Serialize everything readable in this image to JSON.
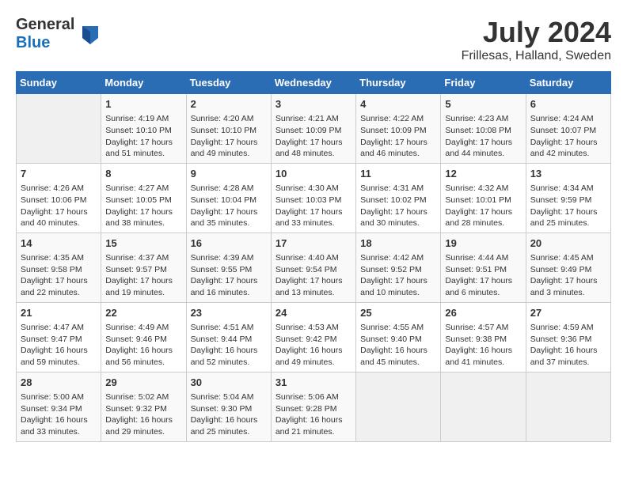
{
  "logo": {
    "general": "General",
    "blue": "Blue"
  },
  "title": "July 2024",
  "location": "Frillesas, Halland, Sweden",
  "days_header": [
    "Sunday",
    "Monday",
    "Tuesday",
    "Wednesday",
    "Thursday",
    "Friday",
    "Saturday"
  ],
  "weeks": [
    [
      {
        "day": "",
        "info": ""
      },
      {
        "day": "1",
        "info": "Sunrise: 4:19 AM\nSunset: 10:10 PM\nDaylight: 17 hours\nand 51 minutes."
      },
      {
        "day": "2",
        "info": "Sunrise: 4:20 AM\nSunset: 10:10 PM\nDaylight: 17 hours\nand 49 minutes."
      },
      {
        "day": "3",
        "info": "Sunrise: 4:21 AM\nSunset: 10:09 PM\nDaylight: 17 hours\nand 48 minutes."
      },
      {
        "day": "4",
        "info": "Sunrise: 4:22 AM\nSunset: 10:09 PM\nDaylight: 17 hours\nand 46 minutes."
      },
      {
        "day": "5",
        "info": "Sunrise: 4:23 AM\nSunset: 10:08 PM\nDaylight: 17 hours\nand 44 minutes."
      },
      {
        "day": "6",
        "info": "Sunrise: 4:24 AM\nSunset: 10:07 PM\nDaylight: 17 hours\nand 42 minutes."
      }
    ],
    [
      {
        "day": "7",
        "info": "Sunrise: 4:26 AM\nSunset: 10:06 PM\nDaylight: 17 hours\nand 40 minutes."
      },
      {
        "day": "8",
        "info": "Sunrise: 4:27 AM\nSunset: 10:05 PM\nDaylight: 17 hours\nand 38 minutes."
      },
      {
        "day": "9",
        "info": "Sunrise: 4:28 AM\nSunset: 10:04 PM\nDaylight: 17 hours\nand 35 minutes."
      },
      {
        "day": "10",
        "info": "Sunrise: 4:30 AM\nSunset: 10:03 PM\nDaylight: 17 hours\nand 33 minutes."
      },
      {
        "day": "11",
        "info": "Sunrise: 4:31 AM\nSunset: 10:02 PM\nDaylight: 17 hours\nand 30 minutes."
      },
      {
        "day": "12",
        "info": "Sunrise: 4:32 AM\nSunset: 10:01 PM\nDaylight: 17 hours\nand 28 minutes."
      },
      {
        "day": "13",
        "info": "Sunrise: 4:34 AM\nSunset: 9:59 PM\nDaylight: 17 hours\nand 25 minutes."
      }
    ],
    [
      {
        "day": "14",
        "info": "Sunrise: 4:35 AM\nSunset: 9:58 PM\nDaylight: 17 hours\nand 22 minutes."
      },
      {
        "day": "15",
        "info": "Sunrise: 4:37 AM\nSunset: 9:57 PM\nDaylight: 17 hours\nand 19 minutes."
      },
      {
        "day": "16",
        "info": "Sunrise: 4:39 AM\nSunset: 9:55 PM\nDaylight: 17 hours\nand 16 minutes."
      },
      {
        "day": "17",
        "info": "Sunrise: 4:40 AM\nSunset: 9:54 PM\nDaylight: 17 hours\nand 13 minutes."
      },
      {
        "day": "18",
        "info": "Sunrise: 4:42 AM\nSunset: 9:52 PM\nDaylight: 17 hours\nand 10 minutes."
      },
      {
        "day": "19",
        "info": "Sunrise: 4:44 AM\nSunset: 9:51 PM\nDaylight: 17 hours\nand 6 minutes."
      },
      {
        "day": "20",
        "info": "Sunrise: 4:45 AM\nSunset: 9:49 PM\nDaylight: 17 hours\nand 3 minutes."
      }
    ],
    [
      {
        "day": "21",
        "info": "Sunrise: 4:47 AM\nSunset: 9:47 PM\nDaylight: 16 hours\nand 59 minutes."
      },
      {
        "day": "22",
        "info": "Sunrise: 4:49 AM\nSunset: 9:46 PM\nDaylight: 16 hours\nand 56 minutes."
      },
      {
        "day": "23",
        "info": "Sunrise: 4:51 AM\nSunset: 9:44 PM\nDaylight: 16 hours\nand 52 minutes."
      },
      {
        "day": "24",
        "info": "Sunrise: 4:53 AM\nSunset: 9:42 PM\nDaylight: 16 hours\nand 49 minutes."
      },
      {
        "day": "25",
        "info": "Sunrise: 4:55 AM\nSunset: 9:40 PM\nDaylight: 16 hours\nand 45 minutes."
      },
      {
        "day": "26",
        "info": "Sunrise: 4:57 AM\nSunset: 9:38 PM\nDaylight: 16 hours\nand 41 minutes."
      },
      {
        "day": "27",
        "info": "Sunrise: 4:59 AM\nSunset: 9:36 PM\nDaylight: 16 hours\nand 37 minutes."
      }
    ],
    [
      {
        "day": "28",
        "info": "Sunrise: 5:00 AM\nSunset: 9:34 PM\nDaylight: 16 hours\nand 33 minutes."
      },
      {
        "day": "29",
        "info": "Sunrise: 5:02 AM\nSunset: 9:32 PM\nDaylight: 16 hours\nand 29 minutes."
      },
      {
        "day": "30",
        "info": "Sunrise: 5:04 AM\nSunset: 9:30 PM\nDaylight: 16 hours\nand 25 minutes."
      },
      {
        "day": "31",
        "info": "Sunrise: 5:06 AM\nSunset: 9:28 PM\nDaylight: 16 hours\nand 21 minutes."
      },
      {
        "day": "",
        "info": ""
      },
      {
        "day": "",
        "info": ""
      },
      {
        "day": "",
        "info": ""
      }
    ]
  ]
}
